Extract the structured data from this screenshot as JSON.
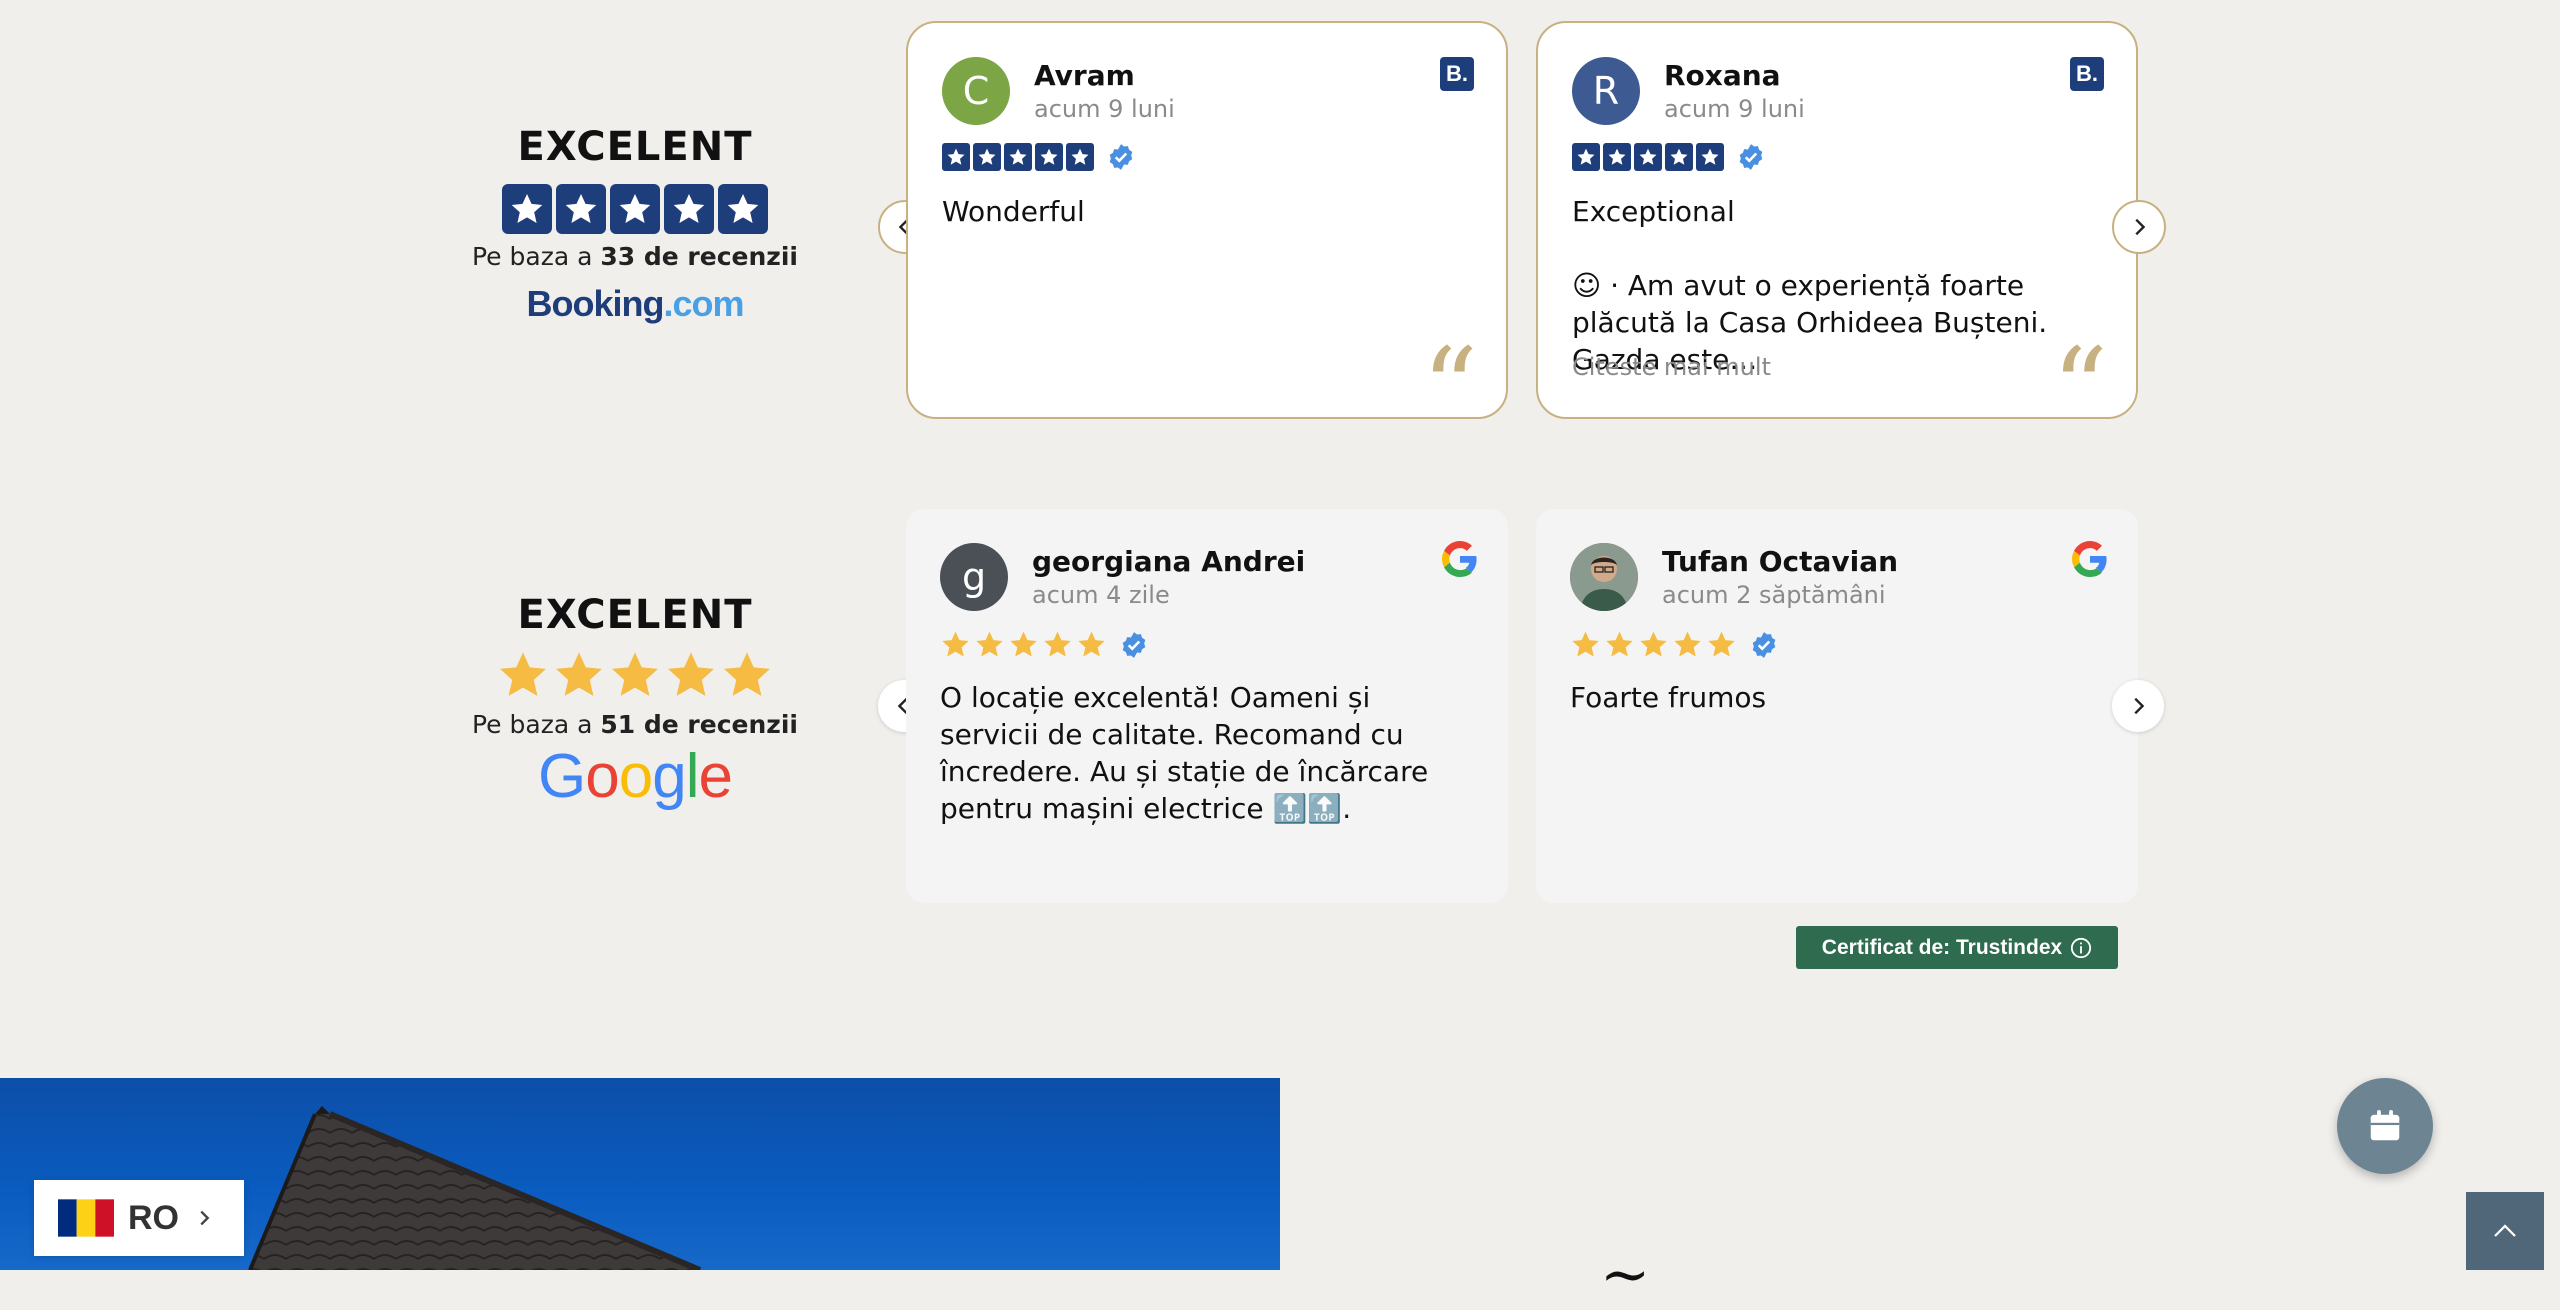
{
  "booking_summary": {
    "rating_label": "EXCELENT",
    "based_prefix": "Pe baza a",
    "based_count": "33 de recenzii",
    "logo_main": "Booking",
    "logo_suffix": ".com",
    "stars": 5
  },
  "google_summary": {
    "rating_label": "EXCELENT",
    "based_prefix": "Pe baza a",
    "based_count": "51 de recenzii",
    "logo_letters": [
      "G",
      "o",
      "o",
      "g",
      "l",
      "e"
    ],
    "logo_colors": [
      "#4285f4",
      "#ea4335",
      "#fbbc05",
      "#4285f4",
      "#34a853",
      "#ea4335"
    ],
    "stars": 5
  },
  "booking_reviews": [
    {
      "initial": "C",
      "avatar_color": "#7ca546",
      "name": "Avram",
      "date": "acum 9 luni",
      "title": "Wonderful",
      "body": "",
      "read_more": "",
      "stars": 5
    },
    {
      "initial": "R",
      "avatar_color": "#3d5a93",
      "name": "Roxana",
      "date": "acum 9 luni",
      "title": "Exceptional",
      "body": "☺ ·  Am avut o experiență foarte plăcută la Casa Orhideea Bușteni. Gazda este…",
      "read_more": "Citeste mai mult",
      "stars": 5
    }
  ],
  "booking_source_badge": "B.",
  "google_reviews": [
    {
      "initial": "g",
      "avatar_color": "#4a5056",
      "name": "georgiana Andrei",
      "date": "acum 4 zile",
      "text": "O locație excelentă! Oameni și servicii de calitate. Recomand cu încredere. Au și stație de încărcare pentru mașini electrice 🔝🔝.",
      "stars": 5
    },
    {
      "initial": "",
      "avatar_color": "#6b7b6a",
      "name": "Tufan Octavian",
      "date": "acum 2 săptămâni",
      "text": "Foarte frumos",
      "stars": 5
    }
  ],
  "certificate": {
    "label": "Certificat de: Trustindex"
  },
  "language": {
    "code": "RO"
  },
  "colors": {
    "page_bg": "#f0efec",
    "booking_blue": "#1e3d7b",
    "gold": "#c8b181",
    "google_star": "#f6bb42",
    "verified": "#4a90e2",
    "trustindex_green": "#2e6b4f",
    "calendar_button": "#6d8593",
    "scroll_top": "#50677a"
  },
  "icons": [
    "star-icon",
    "verified-badge-icon",
    "quote-icon",
    "chevron-left-icon",
    "chevron-right-icon",
    "google-g-icon",
    "booking-b-icon",
    "info-icon",
    "calendar-icon",
    "chevron-up-icon",
    "romania-flag-icon"
  ]
}
